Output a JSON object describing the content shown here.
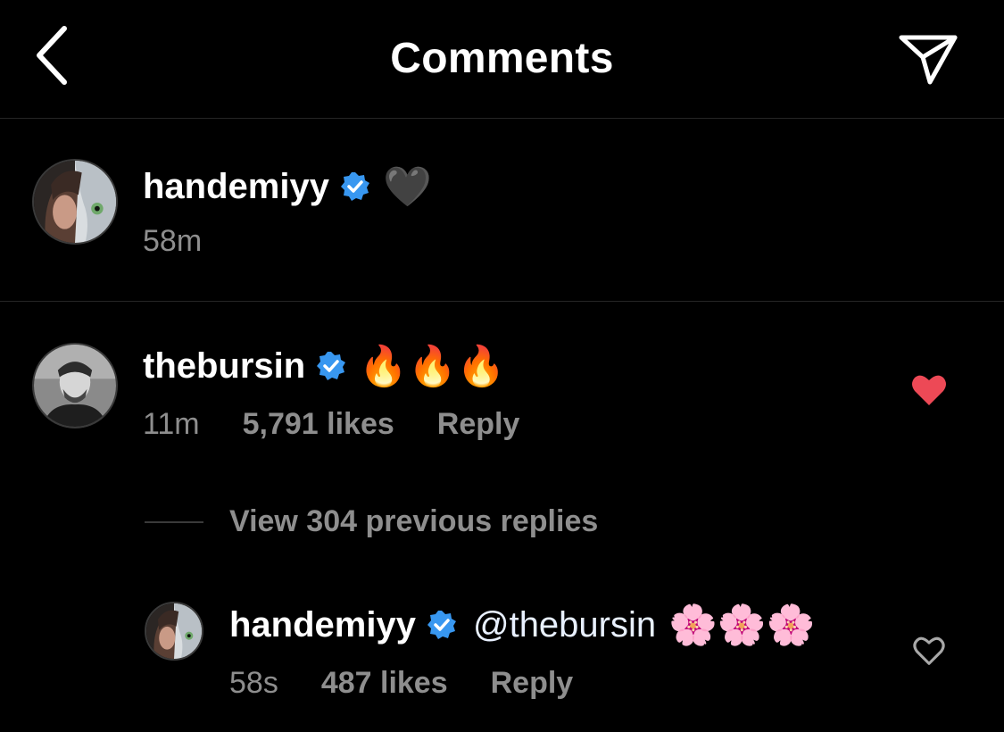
{
  "header": {
    "title": "Comments"
  },
  "icons": {
    "back": "chevron-left-icon",
    "send": "paper-plane-icon",
    "verified": "verified-badge-icon",
    "liked": "heart-filled-icon",
    "unliked": "heart-outline-icon"
  },
  "colors": {
    "accent_blue": "#3897f0",
    "like_red": "#ed4956",
    "muted": "#8e8e8e"
  },
  "caption": {
    "username": "handemiyy",
    "text": "🖤",
    "time": "58m"
  },
  "comment": {
    "username": "thebursin",
    "text": "🔥🔥🔥",
    "time": "11m",
    "likes": "5,791 likes",
    "reply_label": "Reply",
    "liked": true
  },
  "view_replies": {
    "label": "View 304 previous replies"
  },
  "reply": {
    "username": "handemiyy",
    "mention": "@thebursin",
    "text": "🌸🌸🌸",
    "time": "58s",
    "likes": "487 likes",
    "reply_label": "Reply",
    "liked": false
  }
}
